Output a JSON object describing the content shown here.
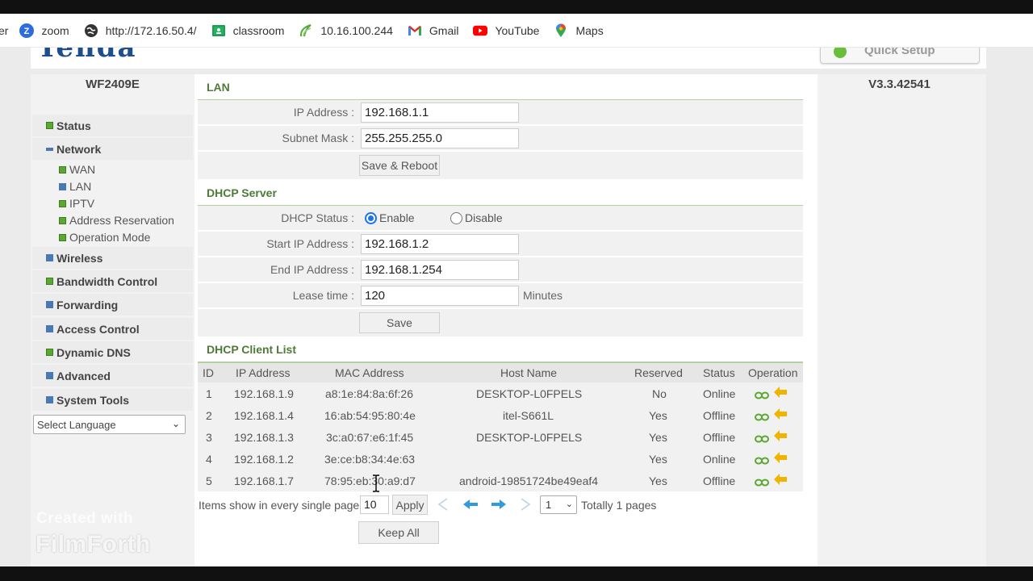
{
  "bookmarks": [
    {
      "label": "er",
      "icon": "cut-off-bookmark"
    },
    {
      "label": "zoom",
      "icon": "zoom-icon"
    },
    {
      "label": "http://172.16.50.4/",
      "icon": "globe-icon"
    },
    {
      "label": "classroom",
      "icon": "classroom-icon"
    },
    {
      "label": "10.16.100.244",
      "icon": "leaf-icon"
    },
    {
      "label": "Gmail",
      "icon": "gmail-icon"
    },
    {
      "label": "YouTube",
      "icon": "youtube-icon"
    },
    {
      "label": "Maps",
      "icon": "maps-icon"
    }
  ],
  "header": {
    "logo_text": "Tenda",
    "quick_setup_label": "Quick Setup"
  },
  "sidebar": {
    "model": "WF2409E",
    "items": [
      {
        "label": "Status",
        "icon": "green-square-icon"
      },
      {
        "label": "Network",
        "icon": "blue-square-icon"
      },
      {
        "label": "Wireless",
        "icon": "grid-icon"
      },
      {
        "label": "Bandwidth Control",
        "icon": "green-square-icon"
      },
      {
        "label": "Forwarding",
        "icon": "grid-icon"
      },
      {
        "label": "Access Control",
        "icon": "grid-icon"
      },
      {
        "label": "Dynamic DNS",
        "icon": "green-square-icon"
      },
      {
        "label": "Advanced",
        "icon": "grid-icon"
      },
      {
        "label": "System Tools",
        "icon": "grid-icon"
      }
    ],
    "network_sub": [
      {
        "label": "WAN",
        "icon": "green-square-icon"
      },
      {
        "label": "LAN",
        "icon": "blue-square-icon"
      },
      {
        "label": "IPTV",
        "icon": "green-square-icon"
      },
      {
        "label": "Address Reservation",
        "icon": "green-square-icon"
      },
      {
        "label": "Operation Mode",
        "icon": "green-square-icon"
      }
    ],
    "language_select": "Select Language"
  },
  "lan": {
    "title": "LAN",
    "ip_label": "IP Address :",
    "ip_value": "192.168.1.1",
    "mask_label": "Subnet Mask :",
    "mask_value": "255.255.255.0",
    "save_reboot": "Save & Reboot"
  },
  "dhcp": {
    "title": "DHCP Server",
    "status_label": "DHCP Status :",
    "enable_label": "Enable",
    "disable_label": "Disable",
    "enabled": true,
    "start_label": "Start IP Address :",
    "start_value": "192.168.1.2",
    "end_label": "End IP Address :",
    "end_value": "192.168.1.254",
    "lease_label": "Lease time :",
    "lease_value": "120",
    "lease_unit": "Minutes",
    "save": "Save"
  },
  "clients": {
    "title": "DHCP Client List",
    "headers": [
      "ID",
      "IP Address",
      "MAC Address",
      "Host Name",
      "Reserved",
      "Status",
      "Operation"
    ],
    "rows": [
      {
        "id": "1",
        "ip": "192.168.1.9",
        "mac": "a8:1e:84:8a:6f:26",
        "host": "DESKTOP-L0FPELS",
        "reserved": "No",
        "status": "Online"
      },
      {
        "id": "2",
        "ip": "192.168.1.4",
        "mac": "16:ab:54:95:80:4e",
        "host": "itel-S661L",
        "reserved": "Yes",
        "status": "Offline"
      },
      {
        "id": "3",
        "ip": "192.168.1.3",
        "mac": "3c:a0:67:e6:1f:45",
        "host": "DESKTOP-L0FPELS",
        "reserved": "Yes",
        "status": "Offline"
      },
      {
        "id": "4",
        "ip": "192.168.1.2",
        "mac": "3e:ce:b8:34:4e:63",
        "host": "",
        "reserved": "Yes",
        "status": "Online"
      },
      {
        "id": "5",
        "ip": "192.168.1.7",
        "mac": "78:95:eb:30:a9:d7",
        "host": "android-19851724be49eaf4",
        "reserved": "Yes",
        "status": "Offline"
      }
    ],
    "pager_label": "Items show in every single page",
    "page_size": "10",
    "apply": "Apply",
    "page_select": "1",
    "total_label": "Totally 1 pages",
    "keep_all": "Keep All"
  },
  "right": {
    "version": "V3.3.42541"
  },
  "watermark": {
    "line1": "Created with",
    "line2": "FilmForth"
  },
  "colors": {
    "section_title": "#4d7a36",
    "accent_blue": "#1a73e8",
    "arrow_orange": "#f0b400",
    "link_green": "#5aa833"
  }
}
